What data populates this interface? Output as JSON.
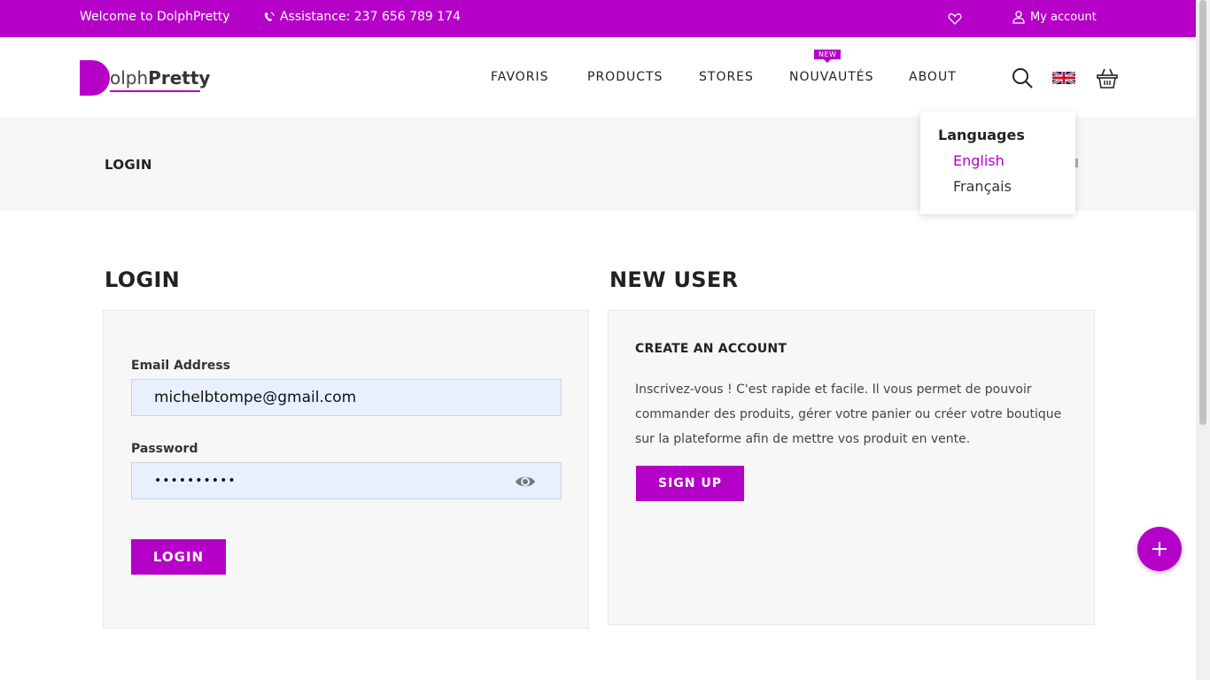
{
  "topbar": {
    "welcome": "Welcome to DolphPretty",
    "assistance": "Assistance: 237 656 789 174",
    "my_account": "My account",
    "icons": [
      "phone-icon",
      "heart-icon",
      "user-icon"
    ]
  },
  "header": {
    "logo_first_letter": "D",
    "logo_light": "olph",
    "logo_bold": "Pretty",
    "nav": [
      "FAVORIS",
      "PRODUCTS",
      "STORES",
      "NOUVAUTÉS",
      "ABOUT"
    ],
    "nav_badge": "NEW",
    "icons": [
      "search-icon",
      "uk-flag-icon",
      "basket-icon"
    ]
  },
  "breadcrumb": {
    "title": "LOGIN"
  },
  "languages": {
    "heading": "Languages",
    "options": [
      "English",
      "Français"
    ],
    "active": "English"
  },
  "login": {
    "heading": "LOGIN",
    "email_label": "Email Address",
    "email_value": "michelbtompe@gmail.com",
    "password_label": "Password",
    "password_value": "••••••••••",
    "button": "LOGIN"
  },
  "new_user": {
    "heading": "NEW USER",
    "subheading": "CREATE AN ACCOUNT",
    "description": "Inscrivez-vous ! C'est rapide et facile. Il vous permet de pouvoir commander des produits, gérer votre panier ou créer votre boutique sur la plateforme afin de mettre vos produit en vente.",
    "button": "SIGN UP"
  },
  "colors": {
    "brand": "#b500c8",
    "input_bg": "#e8f0fe",
    "panel_bg": "#f7f7f7"
  }
}
